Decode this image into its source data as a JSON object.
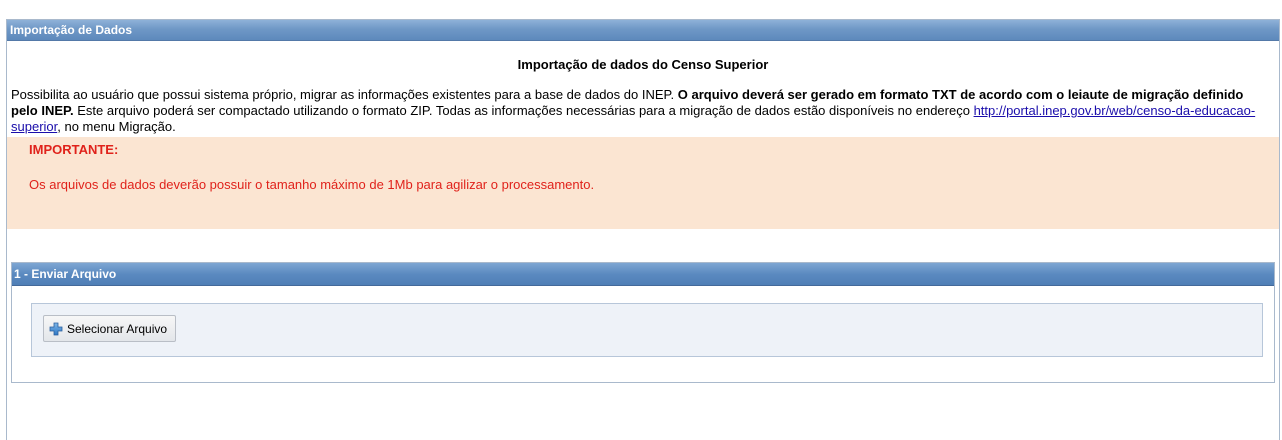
{
  "panel": {
    "title": "Importação de Dados"
  },
  "page": {
    "title": "Importação de dados do Censo Superior",
    "description_part1": "Possibilita ao usuário que possui sistema próprio, migrar as informações existentes para a base de dados do INEP. ",
    "description_bold": "O arquivo deverá ser gerado em formato TXT de acordo com o leiaute de migração definido pelo INEP.",
    "description_part2": " Este arquivo poderá ser compactado utilizando o formato ZIP. Todas as informações necessárias para a migração de dados estão disponíveis no endereço ",
    "link_text": "http://portal.inep.gov.br/web/censo-da-educacao-superior",
    "description_part3": ", no menu Migração."
  },
  "warning": {
    "title": "IMPORTANTE:",
    "text": "Os arquivos de dados deverão possuir o tamanho máximo de 1Mb para agilizar o processamento."
  },
  "section": {
    "title": "1 - Enviar Arquivo",
    "select_button_label": "Selecionar Arquivo",
    "select_button_icon": "plus-icon"
  },
  "colors": {
    "header_blue": "#6f98c6",
    "warning_bg": "#fbe5d2",
    "warning_text": "#e0221b",
    "link": "#1a0dab"
  }
}
